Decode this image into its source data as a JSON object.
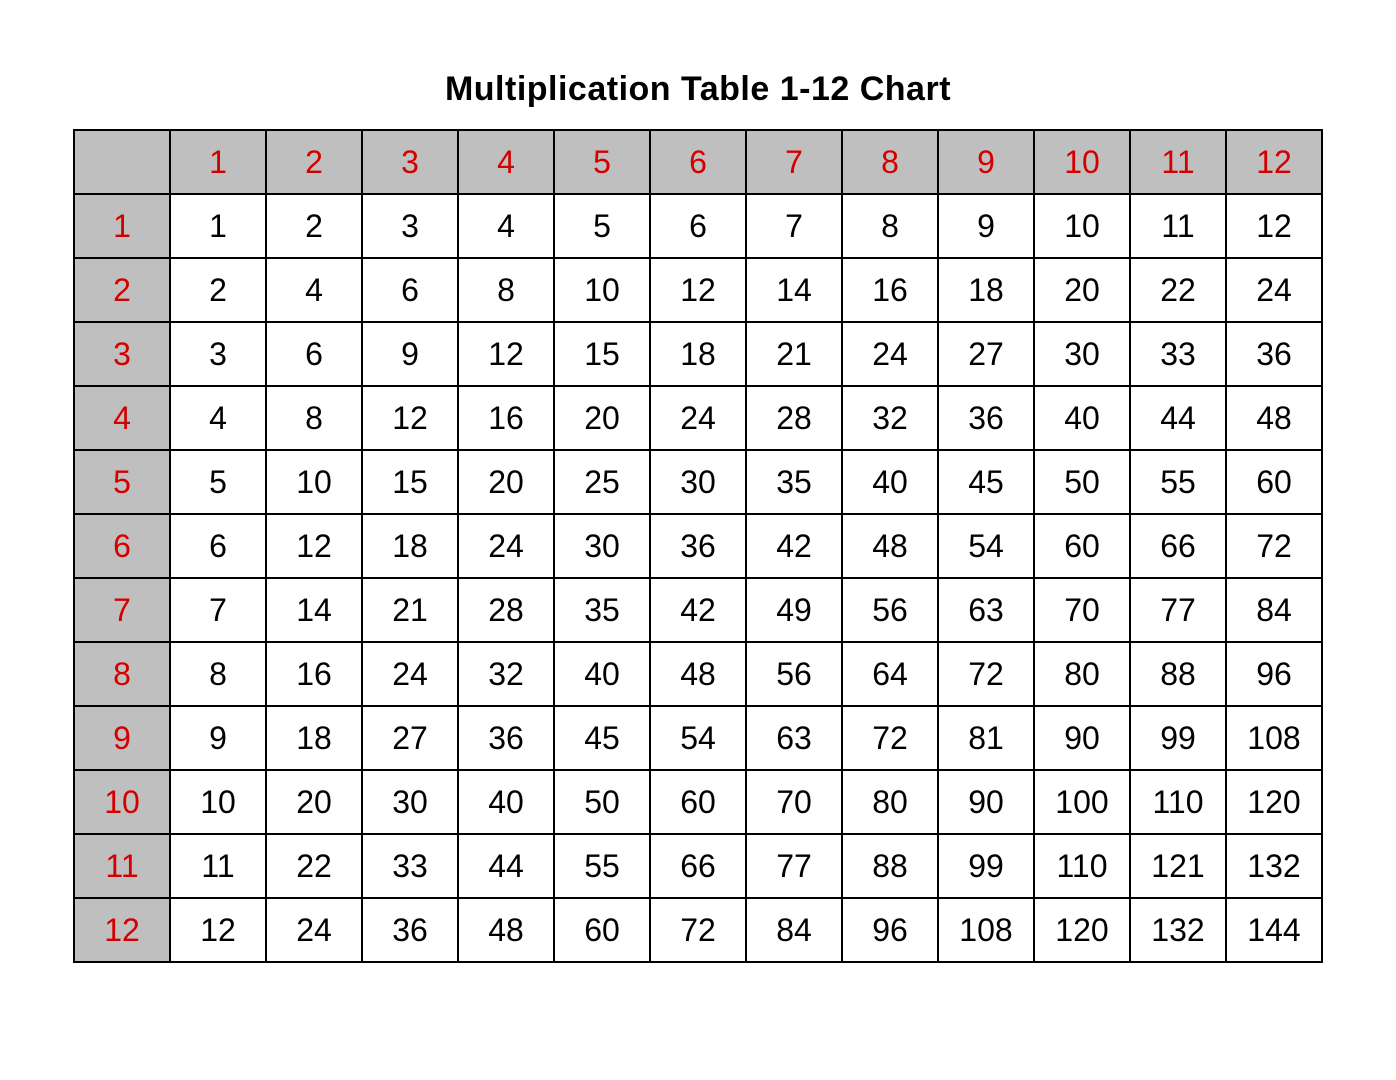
{
  "title": "Multiplication Table 1-12 Chart",
  "chart_data": {
    "type": "table",
    "title": "Multiplication Table 1-12 Chart",
    "col_headers": [
      1,
      2,
      3,
      4,
      5,
      6,
      7,
      8,
      9,
      10,
      11,
      12
    ],
    "row_headers": [
      1,
      2,
      3,
      4,
      5,
      6,
      7,
      8,
      9,
      10,
      11,
      12
    ],
    "values": [
      [
        1,
        2,
        3,
        4,
        5,
        6,
        7,
        8,
        9,
        10,
        11,
        12
      ],
      [
        2,
        4,
        6,
        8,
        10,
        12,
        14,
        16,
        18,
        20,
        22,
        24
      ],
      [
        3,
        6,
        9,
        12,
        15,
        18,
        21,
        24,
        27,
        30,
        33,
        36
      ],
      [
        4,
        8,
        12,
        16,
        20,
        24,
        28,
        32,
        36,
        40,
        44,
        48
      ],
      [
        5,
        10,
        15,
        20,
        25,
        30,
        35,
        40,
        45,
        50,
        55,
        60
      ],
      [
        6,
        12,
        18,
        24,
        30,
        36,
        42,
        48,
        54,
        60,
        66,
        72
      ],
      [
        7,
        14,
        21,
        28,
        35,
        42,
        49,
        56,
        63,
        70,
        77,
        84
      ],
      [
        8,
        16,
        24,
        32,
        40,
        48,
        56,
        64,
        72,
        80,
        88,
        96
      ],
      [
        9,
        18,
        27,
        36,
        45,
        54,
        63,
        72,
        81,
        90,
        99,
        108
      ],
      [
        10,
        20,
        30,
        40,
        50,
        60,
        70,
        80,
        90,
        100,
        110,
        120
      ],
      [
        11,
        22,
        33,
        44,
        55,
        66,
        77,
        88,
        99,
        110,
        121,
        132
      ],
      [
        12,
        24,
        36,
        48,
        60,
        72,
        84,
        96,
        108,
        120,
        132,
        144
      ]
    ]
  }
}
